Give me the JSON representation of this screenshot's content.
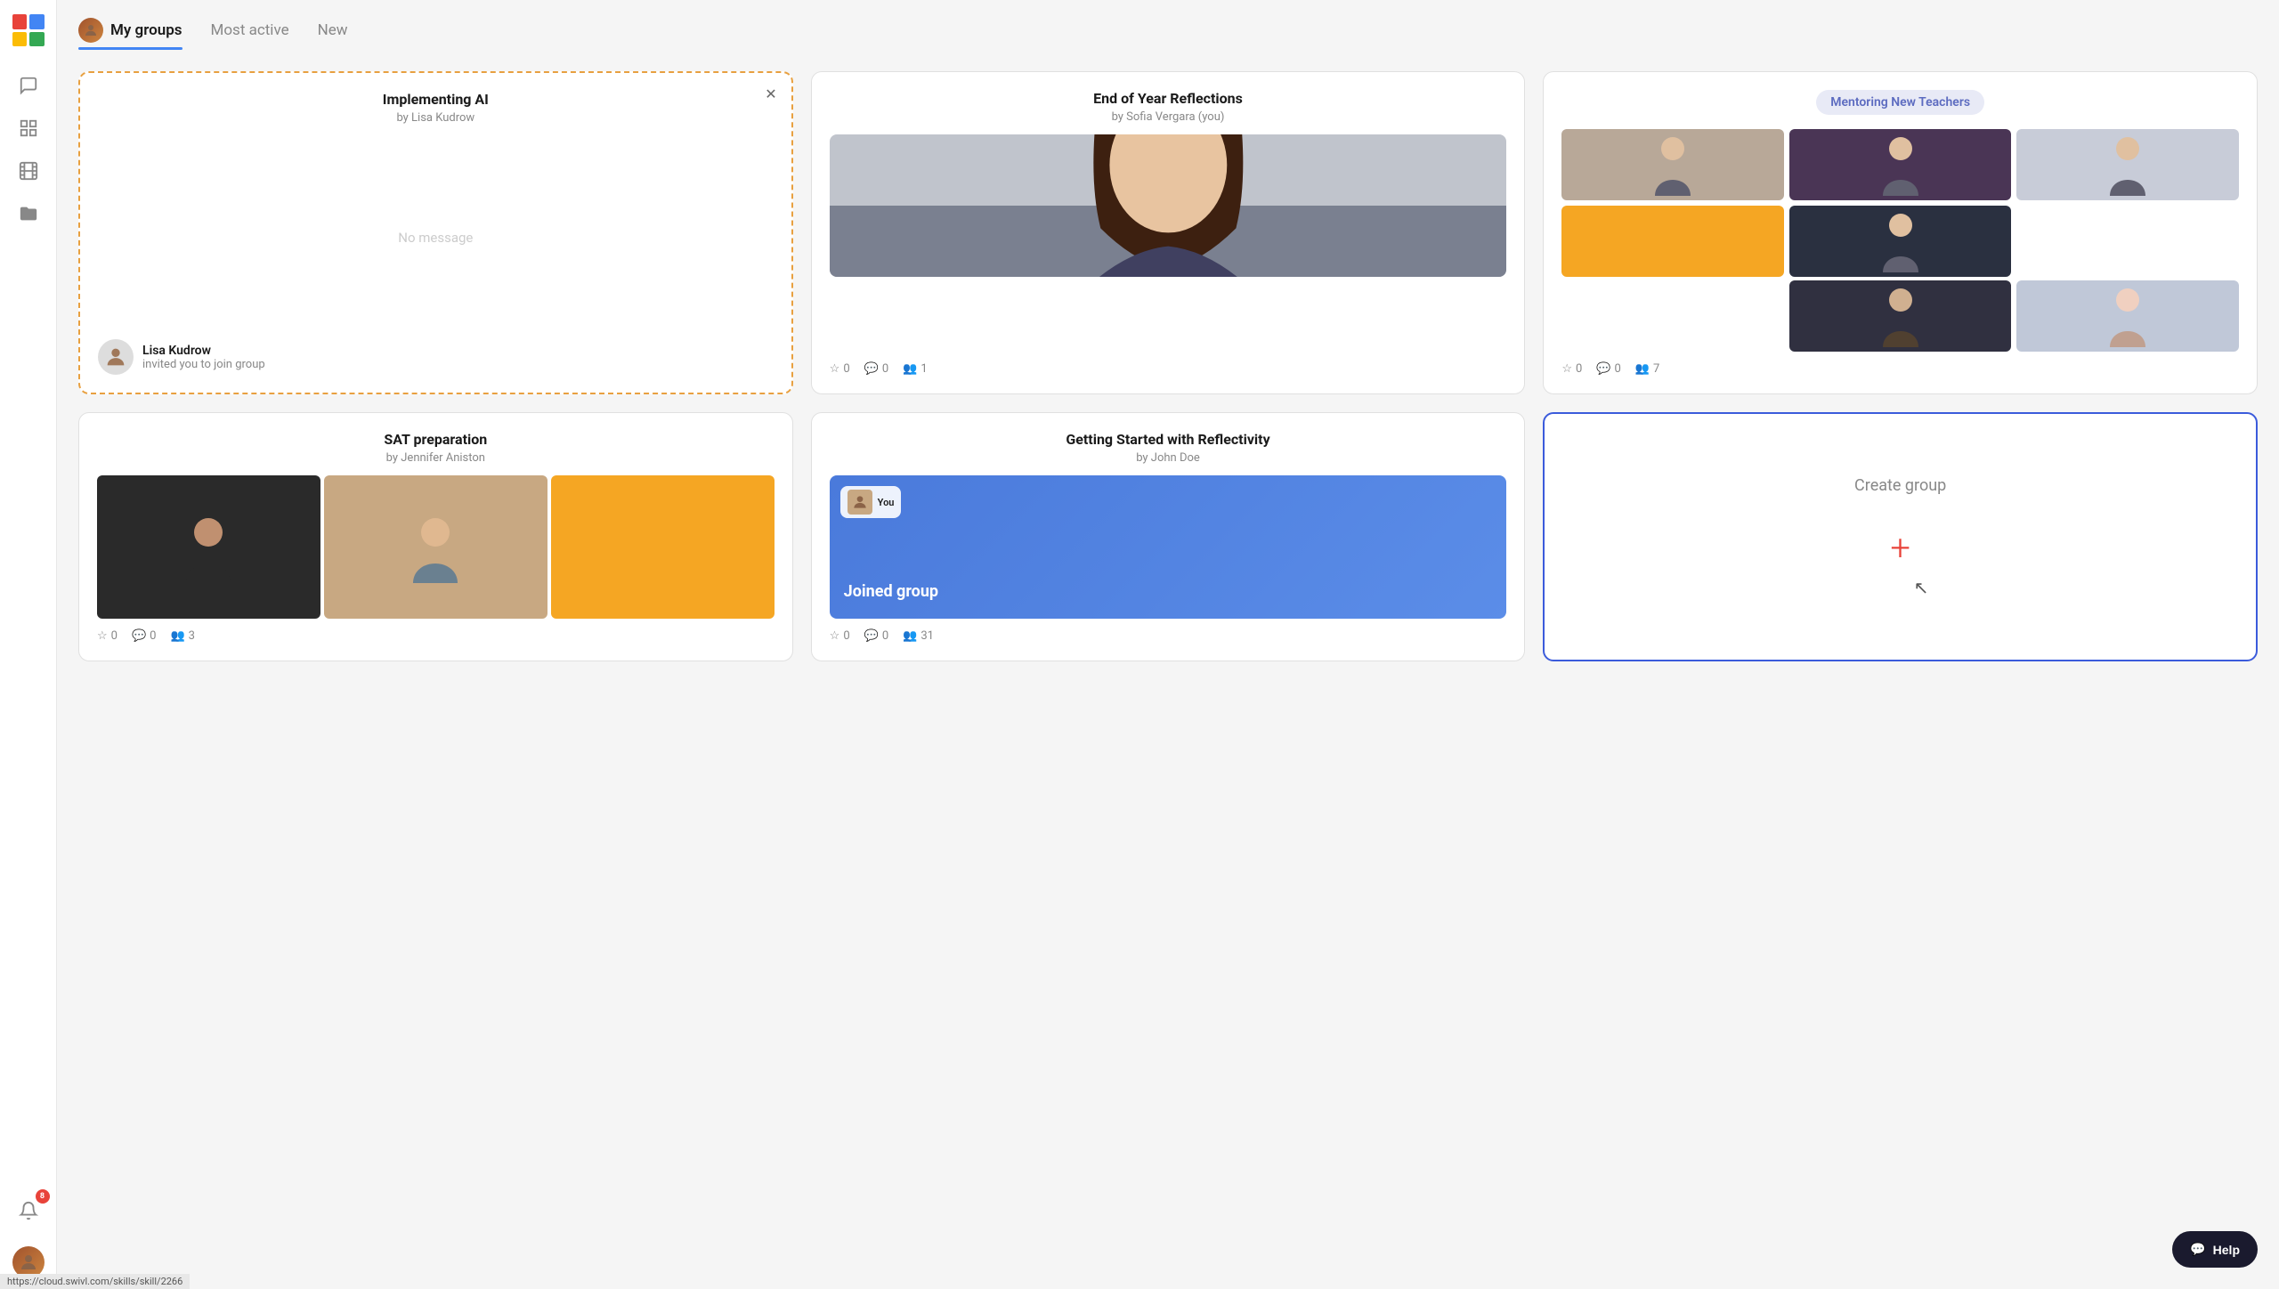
{
  "sidebar": {
    "logo_alts": [
      "red",
      "blue",
      "yellow",
      "green"
    ],
    "icons": [
      "chat",
      "dashboard",
      "film",
      "folder"
    ],
    "notification_count": "8",
    "user_emoji": "👩"
  },
  "tabs": [
    {
      "label": "My groups",
      "active": true,
      "has_avatar": true
    },
    {
      "label": "Most active",
      "active": false
    },
    {
      "label": "New",
      "active": false
    }
  ],
  "cards": [
    {
      "id": "implementing-ai",
      "title": "Implementing AI",
      "subtitle": "by Lisa Kudrow",
      "style": "dashed-orange",
      "has_close": true,
      "content_type": "no_message",
      "no_message_text": "No message",
      "footer_type": "user",
      "footer_name": "Lisa Kudrow",
      "footer_action": "invited you to join group"
    },
    {
      "id": "end-of-year",
      "title": "End of Year Reflections",
      "subtitle": "by Sofia Vergara (you)",
      "style": "solid-gray",
      "content_type": "portrait",
      "stats": {
        "stars": "0",
        "comments": "0",
        "members": "1"
      }
    },
    {
      "id": "mentoring-new-teachers",
      "title": "Mentoring New Teachers",
      "style": "solid-gray",
      "content_type": "member_grid",
      "badge": "Mentoring New Teachers",
      "stats": {
        "stars": "0",
        "comments": "0",
        "members": "7"
      }
    },
    {
      "id": "sat-preparation",
      "title": "SAT preparation",
      "subtitle": "by Jennifer Aniston",
      "style": "solid-gray",
      "content_type": "collage",
      "stats": {
        "stars": "0",
        "comments": "0",
        "members": "3"
      }
    },
    {
      "id": "getting-started",
      "title": "Getting Started with Reflectivity",
      "subtitle": "by John Doe",
      "style": "solid-gray",
      "content_type": "joined",
      "joined_text": "Joined group",
      "you_label": "You",
      "stats": {
        "stars": "0",
        "comments": "0",
        "members": "31"
      }
    },
    {
      "id": "create-group",
      "title": "Create group",
      "style": "solid-blue",
      "content_type": "create"
    }
  ],
  "help_button_label": "Help",
  "url_bar": "https://cloud.swivl.com/skills/skill/2266"
}
